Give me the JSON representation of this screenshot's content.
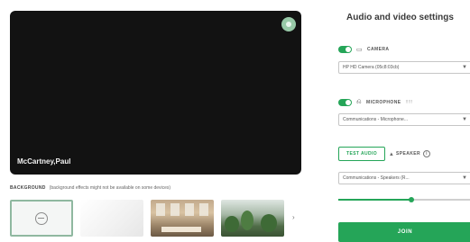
{
  "preview": {
    "participant_name": "McCartney,Paul",
    "camera_indicator_icon": "camera-status-icon"
  },
  "background": {
    "label": "BACKGROUND",
    "note": "(background effects might not be available on some devices)",
    "options": [
      {
        "name": "none",
        "icon": "no-background-icon",
        "selected": true
      },
      {
        "name": "white"
      },
      {
        "name": "office"
      },
      {
        "name": "plants"
      }
    ],
    "next_icon": "chevron-right-icon",
    "next_glyph": "›"
  },
  "settings": {
    "title": "Audio and video settings",
    "camera": {
      "label": "CAMERA",
      "icon": "camera-icon",
      "enabled": true,
      "device": "HP HD Camera (05c8:03cb)"
    },
    "microphone": {
      "label": "MICROPHONE",
      "extra": "!!!!!",
      "icon": "microphone-icon",
      "enabled": true,
      "device": "Communications - Microphone..."
    },
    "test_audio_label": "TEST AUDIO",
    "speaker": {
      "label": "SPEAKER",
      "icon": "speaker-icon",
      "device": "Communications - Speakers (R..."
    },
    "volume": 0.55,
    "join_label": "JOIN"
  },
  "colors": {
    "accent": "#25a558",
    "preview_bg": "#121212"
  }
}
